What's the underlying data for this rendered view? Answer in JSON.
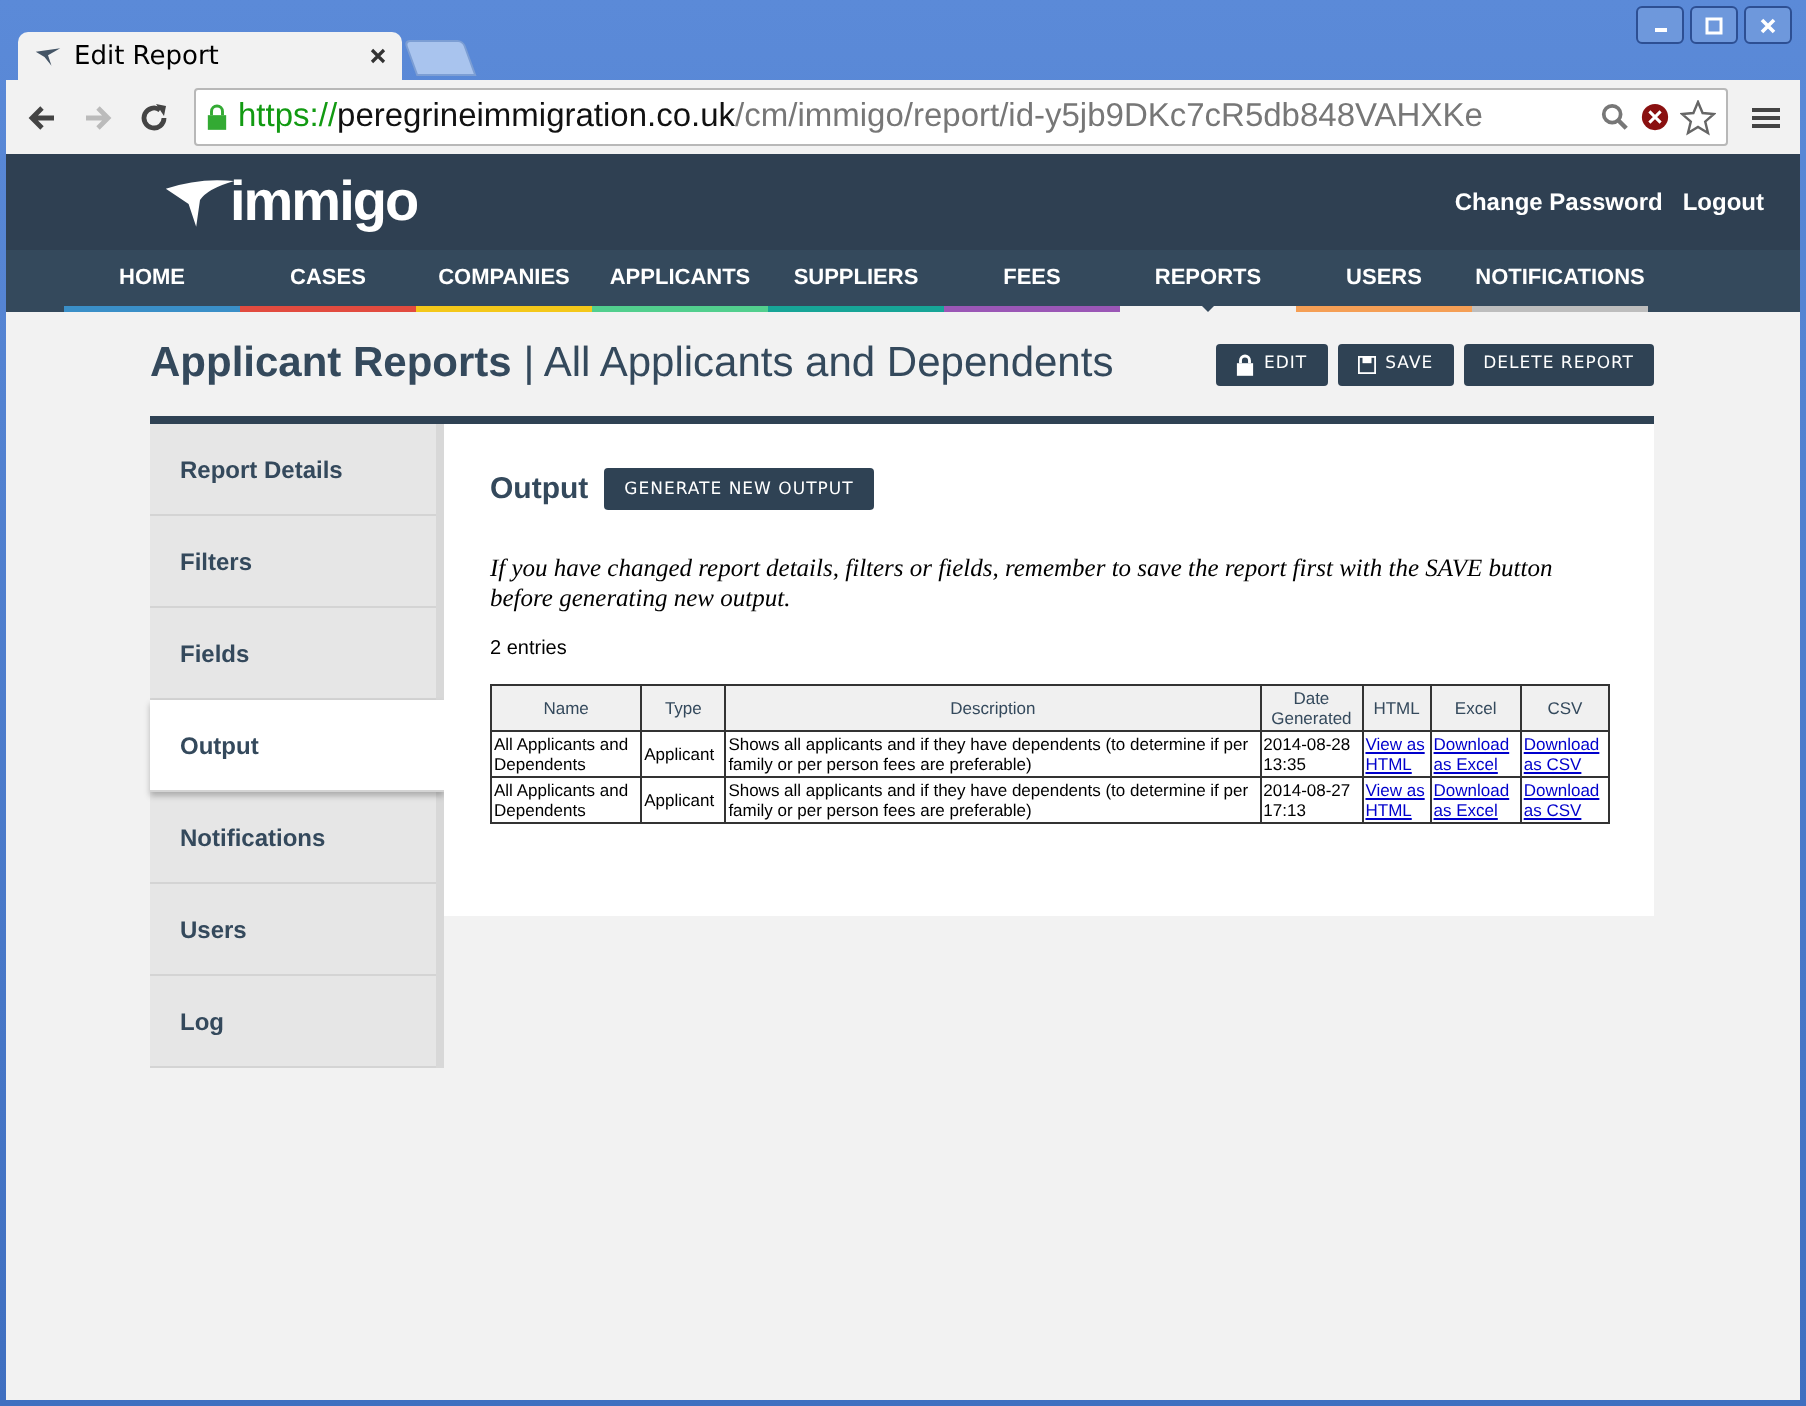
{
  "browser": {
    "tab_title": "Edit Report",
    "url": {
      "scheme": "https://",
      "host": "peregrineimmigration.co.uk",
      "path": "/cm/immigo/report/id-y5jb9DKc7cR5db848VAHXKe"
    }
  },
  "header": {
    "logo": "immigo",
    "links": [
      "Change Password",
      "Logout"
    ]
  },
  "nav": [
    {
      "label": "HOME",
      "selected": false,
      "color": "#3a8fc8"
    },
    {
      "label": "CASES",
      "selected": false,
      "color": "#e24b3f"
    },
    {
      "label": "COMPANIES",
      "selected": false,
      "color": "#f4c81a"
    },
    {
      "label": "APPLICANTS",
      "selected": false,
      "color": "#52cf8e"
    },
    {
      "label": "SUPPLIERS",
      "selected": false,
      "color": "#17a597"
    },
    {
      "label": "FEES",
      "selected": false,
      "color": "#9b57b6"
    },
    {
      "label": "REPORTS",
      "selected": true
    },
    {
      "label": "USERS",
      "selected": false,
      "color": "#f59f55"
    },
    {
      "label": "NOTIFICATIONS",
      "selected": false,
      "color": "#bdbdbd"
    }
  ],
  "page_title": {
    "main": "Applicant Reports",
    "separator": "|",
    "sub": "All Applicants and Dependents"
  },
  "actions": [
    {
      "label": "EDIT",
      "kind": "lock"
    },
    {
      "label": "SAVE",
      "kind": "disk"
    },
    {
      "label": "DELETE REPORT",
      "kind": "plain"
    }
  ],
  "sidebar": [
    {
      "label": "Report Details",
      "selected": false
    },
    {
      "label": "Filters",
      "selected": false
    },
    {
      "label": "Fields",
      "selected": false
    },
    {
      "label": "Output",
      "selected": true
    },
    {
      "label": "Notifications",
      "selected": false
    },
    {
      "label": "Users",
      "selected": false
    },
    {
      "label": "Log",
      "selected": false
    }
  ],
  "output": {
    "heading": "Output",
    "generate_button": "GENERATE NEW OUTPUT",
    "notice": "If you have changed report details, filters or fields, remember to save the report first with the SAVE button before generating new output.",
    "entries": "2 entries",
    "table": {
      "columns": [
        "Name",
        "Type",
        "Description",
        "Date Generated",
        "HTML",
        "Excel",
        "CSV"
      ],
      "rows": [
        [
          "All Applicants and Dependents",
          "Applicant",
          "Shows all applicants and if they have dependents (to determine if per family or per person fees are preferable)",
          "2014-08-28 13:35",
          "View as HTML",
          "Download as Excel",
          "Download as CSV"
        ],
        [
          "All Applicants and Dependents",
          "Applicant",
          "Shows all applicants and if they have dependents (to determine if per family or per person fees are preferable)",
          "2014-08-27 17:13",
          "View as HTML",
          "Download as Excel",
          "Download as CSV"
        ]
      ]
    }
  }
}
